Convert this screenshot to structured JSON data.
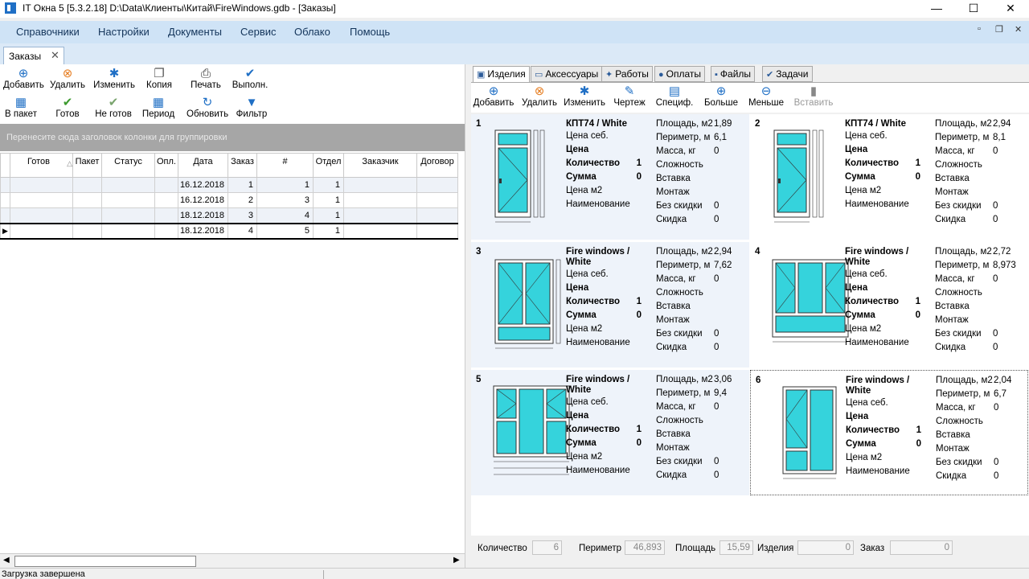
{
  "window": {
    "title": "IT Окна 5 [5.3.2.18] D:\\Data\\Клиенты\\Китай\\FireWindows.gdb - [Заказы]",
    "minimize": "—",
    "maximize": "☐",
    "close": "✕"
  },
  "menu": [
    "Справочники",
    "Настройки",
    "Документы",
    "Сервис",
    "Облако",
    "Помощь"
  ],
  "mdi_controls": {
    "min": "▫",
    "restore": "❐",
    "close": "✕"
  },
  "doc_tab": {
    "label": "Заказы",
    "close": "✕"
  },
  "orders_toolbar": {
    "row1": [
      {
        "label": "Добавить",
        "icon": "add-icon",
        "color": "#1f6fc5"
      },
      {
        "label": "Удалить",
        "icon": "delete-icon",
        "color": "#e67e22"
      },
      {
        "label": "Изменить",
        "icon": "gear-icon",
        "color": "#1f6fc5"
      },
      {
        "label": "Копия",
        "icon": "copy-icon",
        "color": "#555555"
      },
      {
        "label": "Печать",
        "icon": "printer-icon",
        "color": "#333333"
      },
      {
        "label": "Выполн.",
        "icon": "check-circle-icon",
        "color": "#1f6fc5"
      }
    ],
    "row2": [
      {
        "label": "В пакет",
        "icon": "package-icon",
        "color": "#1f6fc5"
      },
      {
        "label": "Готов",
        "icon": "check-icon",
        "color": "#3c9a2e"
      },
      {
        "label": "Не готов",
        "icon": "check-gray-icon",
        "color": "#7aa46e"
      },
      {
        "label": "Период",
        "icon": "calendar-icon",
        "color": "#1f6fc5"
      },
      {
        "label": "Обновить",
        "icon": "refresh-icon",
        "color": "#1f6fc5"
      },
      {
        "label": "Фильтр",
        "icon": "filter-icon",
        "color": "#1f6fc5"
      }
    ]
  },
  "group_panel_text": "Перенесите сюда заголовок колонки для группировки",
  "orders_grid": {
    "columns": [
      "Готов",
      "Пакет",
      "Статус",
      "Опл.",
      "Дата",
      "Заказ",
      "#",
      "Отдел",
      "Заказчик",
      "Договор"
    ],
    "sort_marker": "△",
    "rows": [
      {
        "date": "16.12.2018",
        "order": "1",
        "num": "1",
        "dept": "1"
      },
      {
        "date": "16.12.2018",
        "order": "2",
        "num": "3",
        "dept": "1"
      },
      {
        "date": "18.12.2018",
        "order": "3",
        "num": "4",
        "dept": "1"
      },
      {
        "date": "18.12.2018",
        "order": "4",
        "num": "5",
        "dept": "1"
      }
    ]
  },
  "right_tabs": [
    {
      "label": "Изделия",
      "icon": "item-icon"
    },
    {
      "label": "Аксессуары",
      "icon": "ruler-icon"
    },
    {
      "label": "Работы",
      "icon": "wrench-icon"
    },
    {
      "label": "Оплаты",
      "icon": "money-bag-icon"
    },
    {
      "label": "Файлы",
      "icon": "save-icon"
    },
    {
      "label": "Задачи",
      "icon": "check-icon"
    }
  ],
  "items_toolbar": [
    {
      "label": "Добавить",
      "icon": "add-icon",
      "color": "#1f6fc5"
    },
    {
      "label": "Удалить",
      "icon": "delete-icon",
      "color": "#e67e22"
    },
    {
      "label": "Изменить",
      "icon": "gear-icon",
      "color": "#1f6fc5"
    },
    {
      "label": "Чертеж",
      "icon": "pencil-icon",
      "color": "#1f6fc5"
    },
    {
      "label": "Специф.",
      "icon": "spec-icon",
      "color": "#1f6fc5"
    },
    {
      "label": "Больше",
      "icon": "plus-circle-icon",
      "color": "#1f6fc5"
    },
    {
      "label": "Меньше",
      "icon": "minus-circle-icon",
      "color": "#1f6fc5"
    },
    {
      "label": "Вставить",
      "icon": "paste-icon",
      "color": "#888888",
      "disabled": true
    }
  ],
  "item_labels": {
    "cost": "Цена себ.",
    "price": "Цена",
    "qty": "Количество",
    "sum": "Сумма",
    "price_m2": "Цена м2",
    "naming": "Наименование",
    "area": "Площадь, м2",
    "perimeter": "Периметр, м",
    "mass": "Масса, кг",
    "complexity": "Сложность",
    "insert": "Вставка",
    "mounting": "Монтаж",
    "no_discount": "Без скидки",
    "discount": "Скидка"
  },
  "items": [
    {
      "num": "1",
      "name": "КПТ74 / White",
      "qty": "1",
      "sum": "0",
      "area": "1,89",
      "perimeter": "6,1",
      "mass": "0",
      "no_discount": "0",
      "discount": "0"
    },
    {
      "num": "2",
      "name": "КПТ74 / White",
      "qty": "1",
      "sum": "0",
      "area": "2,94",
      "perimeter": "8,1",
      "mass": "0",
      "no_discount": "0",
      "discount": "0"
    },
    {
      "num": "3",
      "name": "Fire windows / White",
      "qty": "1",
      "sum": "0",
      "area": "2,94",
      "perimeter": "7,62",
      "mass": "0",
      "no_discount": "0",
      "discount": "0"
    },
    {
      "num": "4",
      "name": "Fire windows / White",
      "qty": "1",
      "sum": "0",
      "area": "2,72",
      "perimeter": "8,973",
      "mass": "0",
      "no_discount": "0",
      "discount": "0"
    },
    {
      "num": "5",
      "name": "Fire windows / White",
      "qty": "1",
      "sum": "0",
      "area": "3,06",
      "perimeter": "9,4",
      "mass": "0",
      "no_discount": "0",
      "discount": "0"
    },
    {
      "num": "6",
      "name": "Fire windows / White",
      "qty": "1",
      "sum": "0",
      "area": "2,04",
      "perimeter": "6,7",
      "mass": "0",
      "no_discount": "0",
      "discount": "0"
    }
  ],
  "summary": {
    "qty_label": "Количество",
    "qty_value": "6",
    "perimeter_label": "Периметр",
    "perimeter_value": "46,893",
    "area_label": "Площадь",
    "area_value": "15,59",
    "items_label": "Изделия",
    "items_value": "0",
    "order_label": "Заказ",
    "order_value": "0"
  },
  "status": "Загрузка завершена",
  "colors": {
    "glass": "#35d3dc",
    "frame": "#ffffff",
    "menubar": "#cfe3f6",
    "accent": "#1f6fc5"
  }
}
